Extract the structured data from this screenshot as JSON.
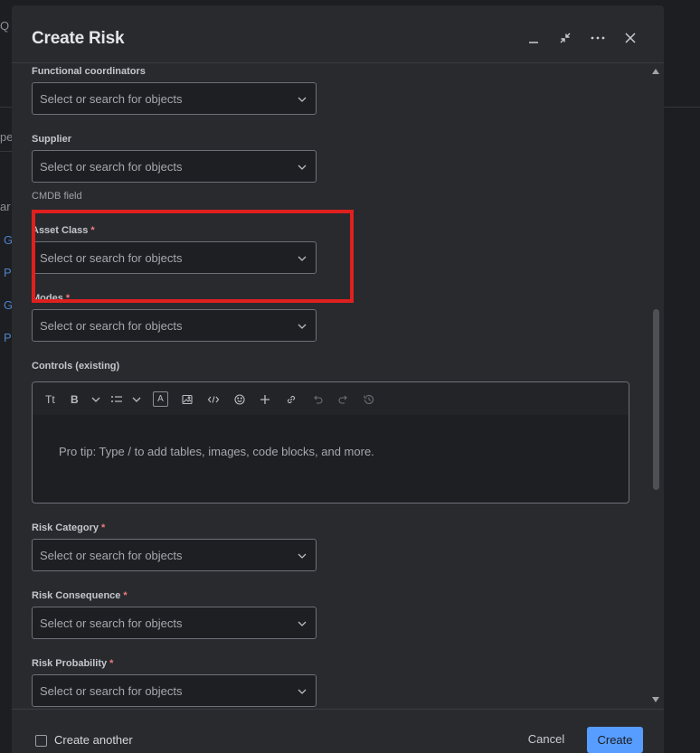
{
  "background": {
    "fragments": [
      "Q",
      "pe",
      "ar",
      "G",
      "P",
      "G",
      "P"
    ]
  },
  "modal": {
    "title": "Create Risk",
    "header_icons": [
      "minimize-icon",
      "shrink-icon",
      "more-icon",
      "close-icon"
    ]
  },
  "fields": {
    "functional_coordinators": {
      "label": "Functional coordinators",
      "placeholder": "Select or search for objects"
    },
    "supplier": {
      "label": "Supplier",
      "placeholder": "Select or search for objects"
    },
    "cmdb_label": "CMDB field",
    "asset_class": {
      "label": "Asset Class",
      "required": "*",
      "placeholder": "Select or search for objects"
    },
    "modes": {
      "label": "Modes",
      "required": "*",
      "placeholder": "Select or search for objects"
    },
    "controls": {
      "label": "Controls (existing)",
      "editor_placeholder": "Pro tip: Type / to add tables, images, code blocks, and more."
    },
    "risk_category": {
      "label": "Risk Category",
      "required": "*",
      "placeholder": "Select or search for objects"
    },
    "risk_consequence": {
      "label": "Risk Consequence",
      "required": "*",
      "placeholder": "Select or search for objects"
    },
    "risk_probability": {
      "label": "Risk Probability",
      "required": "*",
      "placeholder": "Select or search for objects"
    }
  },
  "toolbar": {
    "text_style": "Tt",
    "bold": "B",
    "color": "A"
  },
  "footer": {
    "create_another": "Create another",
    "cancel": "Cancel",
    "create": "Create"
  },
  "colors": {
    "modal_bg": "#282a2e",
    "primary": "#579dff",
    "required": "#f07c7c",
    "highlight": "#e0201e"
  }
}
